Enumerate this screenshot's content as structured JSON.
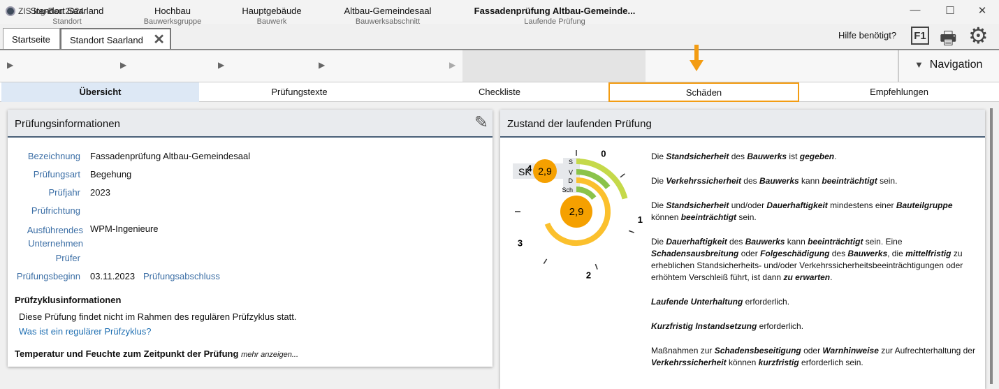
{
  "app": {
    "title": "ZIS Ing-Bau 2024"
  },
  "tabs": [
    {
      "label": "Startseite"
    },
    {
      "label": "Standort Saarland"
    }
  ],
  "header": {
    "help": "Hilfe benötigt?",
    "f1": "F1",
    "navigation": "Navigation"
  },
  "breadcrumb": [
    {
      "title": "Standort Saarland",
      "sub": "Standort"
    },
    {
      "title": "Hochbau",
      "sub": "Bauwerksgruppe"
    },
    {
      "title": "Hauptgebäude",
      "sub": "Bauwerk"
    },
    {
      "title": "Altbau-Gemeindesaal",
      "sub": "Bauwerksabschnitt"
    },
    {
      "title": "Fassadenprüfung Altbau-Gemeinde...",
      "sub": "Laufende Prüfung"
    }
  ],
  "subtabs": [
    "Übersicht",
    "Prüfungstexte",
    "Checkliste",
    "Schäden",
    "Empfehlungen"
  ],
  "colors": {
    "accent": "#f39c12",
    "orange": "#f5a000",
    "lime": "#c5d94a",
    "green": "#8bc34a",
    "yellow": "#fbc02d",
    "label": "#3b6ea5"
  },
  "info": {
    "title": "Prüfungsinformationen",
    "fields": [
      {
        "label": "Bezeichnung",
        "value": "Fassadenprüfung Altbau-Gemeindesaal"
      },
      {
        "label": "Prüfungsart",
        "value": "Begehung"
      },
      {
        "label": "Prüfjahr",
        "value": "2023"
      },
      {
        "label": "Prüfrichtung",
        "value": ""
      },
      {
        "label": "Ausführendes Unternehmen",
        "value": "WPM-Ingenieure"
      },
      {
        "label": "Prüfer",
        "value": ""
      },
      {
        "label": "Prüfungsbeginn",
        "value": "03.11.2023"
      }
    ],
    "end_label": "Prüfungsabschluss",
    "cycle_title": "Prüfzyklusinformationen",
    "cycle_text": "Diese Prüfung findet nicht im Rahmen des regulären Prüfzyklus statt.",
    "cycle_link": "Was ist ein regulärer Prüfzyklus?",
    "temp_title": "Temperatur und Feuchte zum Zeitpunkt der Prüfung",
    "temp_more": "mehr anzeigen..."
  },
  "state": {
    "title": "Zustand der laufenden Prüfung",
    "sk_label": "SK",
    "sk_value": "2,9",
    "center_value": "2,9",
    "rings": [
      {
        "label": "S",
        "value": 0.6
      },
      {
        "label": "V",
        "value": 0.3
      },
      {
        "label": "D",
        "value": 2.9
      },
      {
        "label": "Sch",
        "value": 0.3
      }
    ],
    "scale": [
      "0",
      "1",
      "2",
      "3",
      "4"
    ],
    "paragraphs": [
      "Die <b><i>Standsicherheit</i></b> des <b><i>Bauwerks</i></b> ist <b><i>gegeben</i></b>.",
      "Die <b><i>Verkehrssicherheit</i></b> des <b><i>Bauwerks</i></b> kann <b><i>beeinträchtigt</i></b> sein.",
      "Die <b><i>Standsicherheit</i></b> und/oder <b><i>Dauerhaftigkeit</i></b> mindestens einer <b><i>Bauteilgruppe</i></b> können <b><i>beeinträchtigt</i></b> sein.",
      "Die <b><i>Dauerhaftigkeit</i></b> des <b><i>Bauwerks</i></b> kann <b><i>beeinträchtigt</i></b> sein. Eine <b><i>Schadensausbreitung</i></b> oder <b><i>Folgeschädigung</i></b> des <b><i>Bauwerks</i></b>, die <b><i>mittelfristig</i></b> zu erheblichen Standsicherheits- und/oder Verkehrssicherheitsbeeinträchtigungen oder erhöhtem Verschleiß führt, ist dann <b><i>zu erwarten</i></b>.",
      "<b><i>Laufende Unterhaltung</i></b> erforderlich.",
      "<b><i>Kurzfristig Instandsetzung</i></b> erforderlich.",
      "Maßnahmen zur <b><i>Schadensbeseitigung</i></b> oder <b><i>Warnhinweise</i></b> zur Aufrechterhaltung der <b><i>Verkehrssicherheit</i></b> können <b><i>kurzfristig</i></b> erforderlich sein."
    ]
  }
}
